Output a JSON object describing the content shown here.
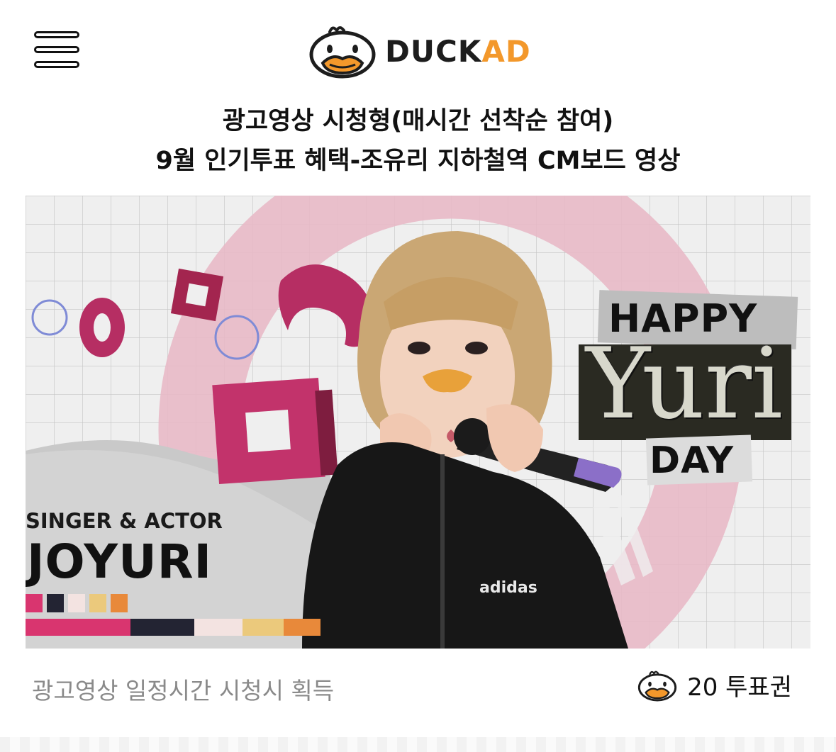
{
  "header": {
    "logo_main": "DUCK",
    "logo_accent": "AD",
    "menu_icon": "hamburger-menu-icon",
    "logo_icon": "duck-icon"
  },
  "title": {
    "line1": "광고영상 시청형(매시간 선착순 참여)",
    "line2": "9월 인기투표 혜택-조유리 지하철역 CM보드 영상"
  },
  "banner": {
    "label": "SINGER & ACTOR",
    "name": "JOYURI",
    "happy": "HAPPY",
    "yuri": "Yuri",
    "day": "DAY",
    "palette": [
      "#d9356f",
      "#232433",
      "#f3e3e1",
      "#ebc97c",
      "#e8893a"
    ]
  },
  "footer": {
    "description": "광고영상 일정시간 시청시 획득",
    "reward": "20 투표권",
    "reward_icon": "duck-icon"
  },
  "colors": {
    "accent": "#f3982b",
    "pink": "#d9356f"
  }
}
